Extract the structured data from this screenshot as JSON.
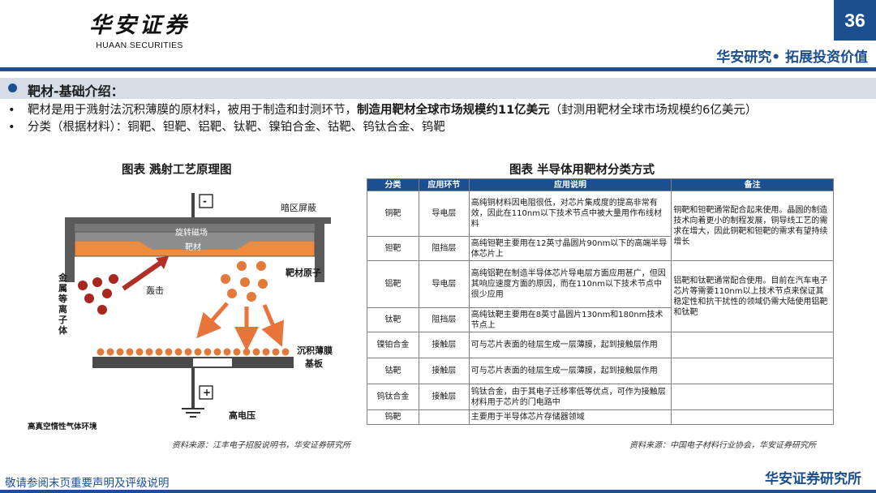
{
  "header": {
    "logo_cn": "华安证券",
    "logo_en": "HUAAN SECURITIES",
    "page_number": "36",
    "slogan": "华安研究• 拓展投资价值"
  },
  "section": {
    "title": "靶材-基础介绍："
  },
  "bullets": [
    {
      "mark": "•",
      "text_before": "靶材是用于溅射法沉积薄膜的原材料，被用于制造和封测环节，",
      "bold": "制造用靶材全球市场规模约11亿美元",
      "text_after": "（封测用靶材全球市场规模约6亿美元）"
    },
    {
      "mark": "•",
      "text": "分类（根据材料）：铜靶、钽靶、铝靶、钛靶、镍铂合金、钴靶、钨钛合金、钨靶"
    }
  ],
  "figure_left": {
    "title": "图表  溅射工艺原理图",
    "labels": {
      "minus": "-",
      "plus": "+",
      "dark_shield": "暗区屏蔽",
      "magnet": "旋转磁场",
      "target": "靶材",
      "target_atoms": "靶材原子",
      "ions": "金属等离子体",
      "bombard": "轰击",
      "film": "沉积薄膜",
      "substrate": "基板",
      "high_voltage": "高电压",
      "vacuum": "高真空惰性气体环境"
    },
    "source": "资料来源：江丰电子招股说明书，华安证券研究所"
  },
  "figure_right": {
    "title": "图表  半导体用靶材分类方式",
    "columns": [
      "分类",
      "应用环节",
      "应用说明",
      "备注"
    ],
    "rows": [
      {
        "type": "铜靶",
        "step": "导电层",
        "desc": "高纯铜材料因电阻很低，对芯片集成度的提高非常有效，因此在110nm以下技术节点中被大量用作布线材料"
      },
      {
        "type": "钽靶",
        "step": "阻挡层",
        "desc": "高纯钽靶主要用在12英寸晶圆片90nm以下的高端半导体芯片上"
      },
      {
        "type": "铝靶",
        "step": "导电层",
        "desc": "高纯铝靶在制造半导体芯片导电层方面应用甚广，但因其响应速度方面的原因，而在110nm以下技术节点中很少应用"
      },
      {
        "type": "钛靶",
        "step": "阻挡层",
        "desc": "高纯钛靶主要用在8英寸晶圆片130nm和180nm技术节点上"
      },
      {
        "type": "镍铂合金",
        "step": "接触层",
        "desc": "可与芯片表面的硅层生成一层薄膜，起到接触层作用"
      },
      {
        "type": "钴靶",
        "step": "接触层",
        "desc": "可与芯片表面的硅层生成一层薄膜，起到接触层作用"
      },
      {
        "type": "钨钛合金",
        "step": "接触层",
        "desc": "钨钛合金，由于其电子迁移率低等优点，可作为接触层材料用于芯片的门电路中"
      },
      {
        "type": "钨靶",
        "step": "",
        "desc": "主要用于半导体芯片存储器领域"
      }
    ],
    "notes": [
      "铜靶和钽靶通常配合起来使用。晶圆的制造技术向着更小的制程发展，铜导线工艺的需求在增大，因此铜靶和钽靶的需求有望持续增长",
      "铝靶和钛靶通常配合使用。目前在汽车电子芯片等需要110nm以上技术节点来保证其稳定性和抗干扰性的领域仍需大陆使用铝靶和钛靶"
    ],
    "source": "资料来源：中国电子材料行业协会，华安证券研究所"
  },
  "footer": {
    "note": "敬请参阅末页重要声明及评级说明",
    "brand": "华安证券研究所"
  },
  "colors": {
    "brand_blue": "#1b4f8f",
    "target_orange": "#f08a3c",
    "ion_red": "#a8271e",
    "atom_orange": "#e27a3a"
  }
}
